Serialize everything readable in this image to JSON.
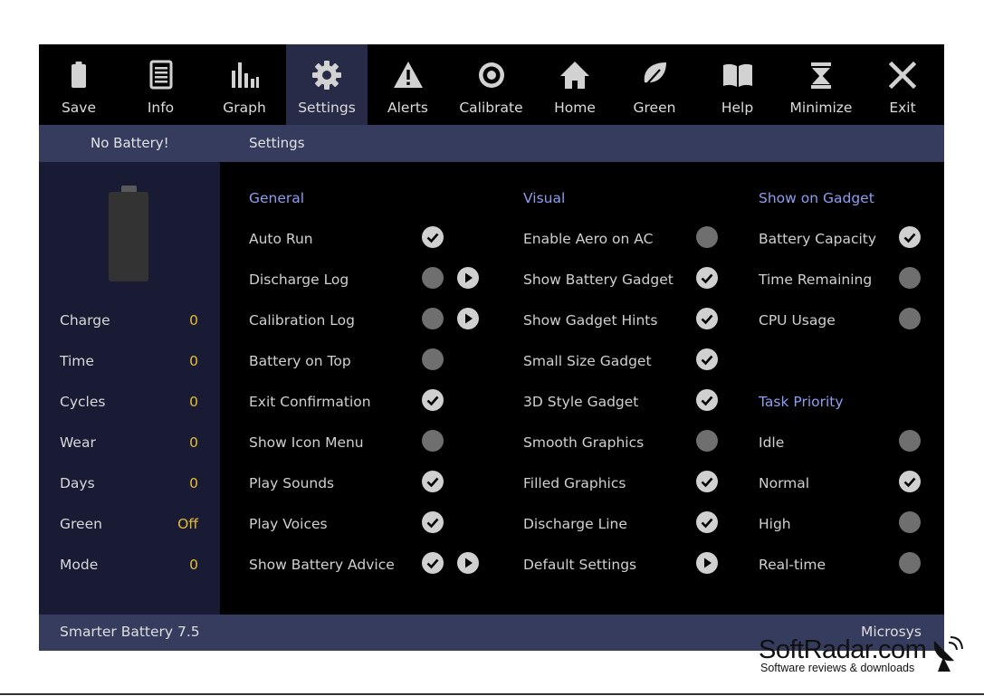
{
  "toolbar": {
    "items": [
      {
        "label": "Save",
        "icon": "battery-icon"
      },
      {
        "label": "Info",
        "icon": "document-icon"
      },
      {
        "label": "Graph",
        "icon": "bar-chart-icon"
      },
      {
        "label": "Settings",
        "icon": "gear-icon",
        "active": true
      },
      {
        "label": "Alerts",
        "icon": "warning-icon"
      },
      {
        "label": "Calibrate",
        "icon": "target-icon"
      },
      {
        "label": "Home",
        "icon": "home-icon"
      },
      {
        "label": "Green",
        "icon": "leaf-icon"
      },
      {
        "label": "Help",
        "icon": "book-icon"
      },
      {
        "label": "Minimize",
        "icon": "minimize-icon"
      },
      {
        "label": "Exit",
        "icon": "close-icon"
      }
    ]
  },
  "subheader": {
    "battery_status": "No Battery!",
    "section_title": "Settings"
  },
  "stats": [
    {
      "label": "Charge",
      "value": "0"
    },
    {
      "label": "Time",
      "value": "0"
    },
    {
      "label": "Cycles",
      "value": "0"
    },
    {
      "label": "Wear",
      "value": "0"
    },
    {
      "label": "Days",
      "value": "0"
    },
    {
      "label": "Green",
      "value": "Off"
    },
    {
      "label": "Mode",
      "value": "0"
    }
  ],
  "general": {
    "title": "General",
    "options": [
      {
        "label": "Auto Run",
        "checked": true
      },
      {
        "label": "Discharge Log",
        "checked": false,
        "has_arrow": true
      },
      {
        "label": "Calibration Log",
        "checked": false,
        "has_arrow": true
      },
      {
        "label": "Battery on Top",
        "checked": false
      },
      {
        "label": "Exit Confirmation",
        "checked": true
      },
      {
        "label": "Show Icon Menu",
        "checked": false
      },
      {
        "label": "Play Sounds",
        "checked": true
      },
      {
        "label": "Play Voices",
        "checked": true
      },
      {
        "label": "Show Battery Advice",
        "checked": true,
        "has_arrow": true
      }
    ]
  },
  "visual": {
    "title": "Visual",
    "options": [
      {
        "label": "Enable Aero on AC",
        "checked": false
      },
      {
        "label": "Show Battery Gadget",
        "checked": true
      },
      {
        "label": "Show Gadget Hints",
        "checked": true
      },
      {
        "label": "Small Size Gadget",
        "checked": true
      },
      {
        "label": "3D Style Gadget",
        "checked": true
      },
      {
        "label": "Smooth Graphics",
        "checked": false
      },
      {
        "label": "Filled Graphics",
        "checked": true
      },
      {
        "label": "Discharge Line",
        "checked": true
      },
      {
        "label": "Default Settings",
        "arrow_only": true
      }
    ]
  },
  "gadget": {
    "title": "Show on Gadget",
    "options": [
      {
        "label": "Battery Capacity",
        "checked": true
      },
      {
        "label": "Time Remaining",
        "checked": false
      },
      {
        "label": "CPU Usage",
        "checked": false
      }
    ]
  },
  "priority": {
    "title": "Task Priority",
    "options": [
      {
        "label": "Idle",
        "checked": false
      },
      {
        "label": "Normal",
        "checked": true
      },
      {
        "label": "High",
        "checked": false
      },
      {
        "label": "Real-time",
        "checked": false
      }
    ]
  },
  "footer": {
    "app_name": "Smarter Battery 7.5",
    "vendor": "Microsys"
  },
  "watermark": {
    "brand": "SoftRadar.com",
    "tagline": "Software reviews & downloads"
  },
  "colors": {
    "accent": "#8d9ef0",
    "value": "#e3bc35",
    "panel": "#363c5e",
    "active_tab": "#272b48"
  }
}
